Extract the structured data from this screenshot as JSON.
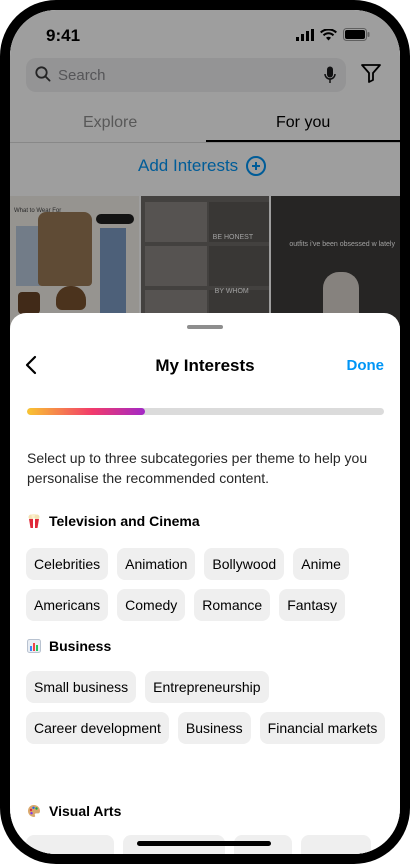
{
  "status_bar": {
    "time": "9:41"
  },
  "search": {
    "placeholder": "Search"
  },
  "tabs": [
    {
      "label": "Explore",
      "selected": false
    },
    {
      "label": "For you",
      "selected": true
    }
  ],
  "add_interests": {
    "label": "Add Interests"
  },
  "feed_thumbnails": [
    {
      "caption": "What to Wear For"
    },
    {
      "labels": [
        "BE HONEST",
        "BY WHOM"
      ]
    },
    {
      "caption": "outfits i've been obsessed w lately"
    }
  ],
  "sheet": {
    "title": "My Interests",
    "done_label": "Done",
    "progress": 0.33,
    "description": "Select up to three subcategories per theme to help you personalise the recommended content.",
    "sections": [
      {
        "icon": "popcorn-icon",
        "title": "Television and Cinema",
        "chips": [
          "Celebrities",
          "Animation",
          "Bollywood",
          "Anime",
          "Americans",
          "Comedy",
          "Romance",
          "Fantasy"
        ]
      },
      {
        "icon": "bar-chart-icon",
        "title": "Business",
        "chips": [
          "Small business",
          "Entrepreneurship",
          "Career development",
          "Business",
          "Financial markets"
        ]
      },
      {
        "icon": "palette-icon",
        "title": "Visual Arts",
        "chips": []
      }
    ]
  },
  "colors": {
    "accent": "#0095f6",
    "progress_gradient": [
      "#f9c531",
      "#f23b6b",
      "#a228c7"
    ]
  }
}
